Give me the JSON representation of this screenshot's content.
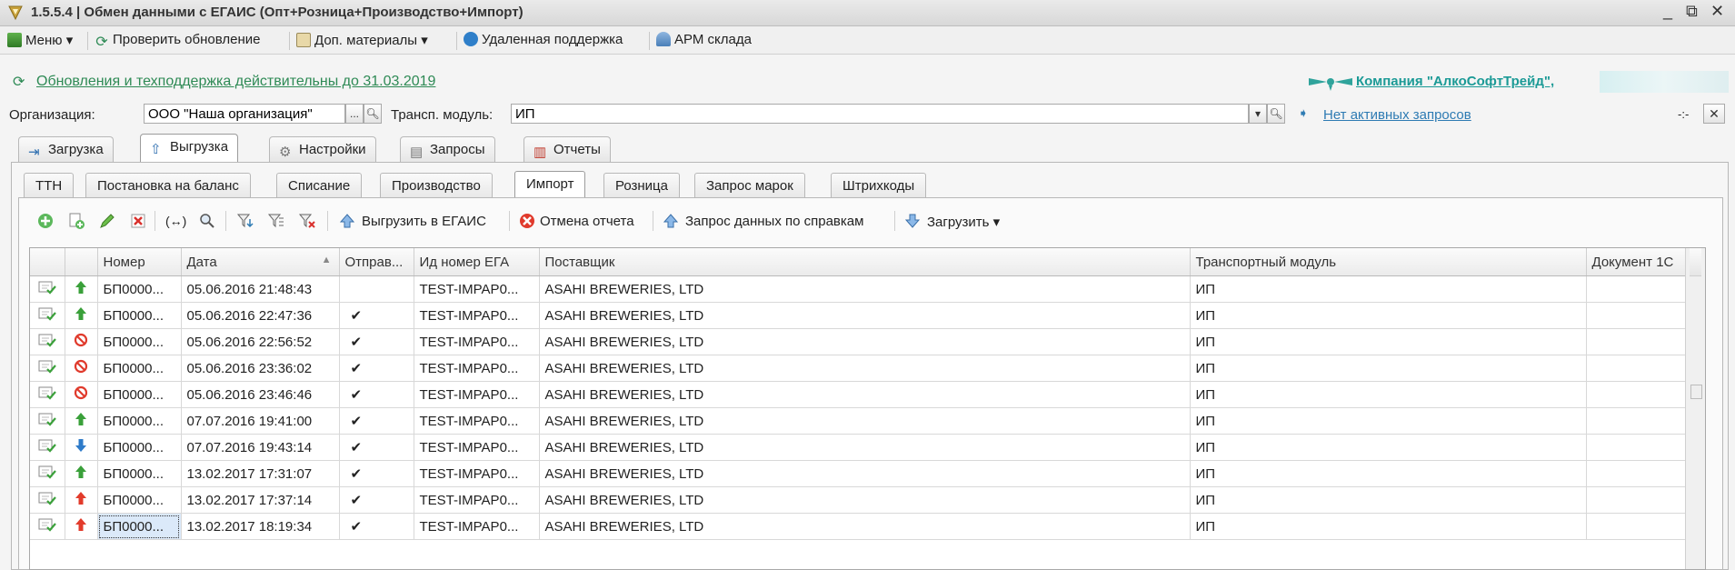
{
  "window": {
    "title": "1.5.5.4 | Обмен данными с ЕГАИС (Опт+Розница+Производство+Импорт)",
    "controls": [
      "_",
      "⧉",
      "✕"
    ]
  },
  "menubar": {
    "items": [
      {
        "label": "Меню ▾",
        "icon": "menu-icon"
      },
      {
        "label": "Проверить обновление",
        "icon": "refresh-icon"
      },
      {
        "label": "Доп. материалы ▾",
        "icon": "clipboard-icon"
      },
      {
        "label": "Удаленная поддержка",
        "icon": "remote-support-icon"
      },
      {
        "label": "АРМ склада",
        "icon": "warehouse-user-icon"
      }
    ]
  },
  "notice": {
    "text": "Обновления и техподдержка действительны до 31.03.2019",
    "company": "Компания \"АлкоСофтТрейд\","
  },
  "filters": {
    "org_label": "Организация:",
    "org_value": "ООО \"Наша организация\"",
    "org_btn": "...",
    "module_label": "Трансп. модуль:",
    "module_value": "ИП",
    "requests_link": "Нет активных запросов",
    "right_mark": "-:-"
  },
  "main_tabs": [
    "Загрузка",
    "Выгрузка",
    "Настройки",
    "Запросы",
    "Отчеты"
  ],
  "sub_tabs": [
    "ТТН",
    "Постановка на баланс",
    "Списание",
    "Производство",
    "Импорт",
    "Розница",
    "Запрос марок",
    "Штрихкоды"
  ],
  "toolbar": {
    "upload": "Выгрузить в ЕГАИС",
    "cancel_report": "Отмена отчета",
    "request_data": "Запрос данных по справкам",
    "load": "Загрузить ▾"
  },
  "grid": {
    "columns": [
      "",
      "",
      "Номер",
      "Дата",
      "Отправ...",
      "Ид номер ЕГА",
      "Поставщик",
      "Транспортный модуль",
      "Документ 1С"
    ],
    "sort_indicator": "▲",
    "rows": [
      {
        "dir": "up-green",
        "num": "БП0000...",
        "date": "05.06.2016 21:48:43",
        "sent": "",
        "ega": "TEST-IMPAP0...",
        "supplier": "ASAHI BREWERIES, LTD",
        "module": "ИП",
        "doc": ""
      },
      {
        "dir": "up-green",
        "num": "БП0000...",
        "date": "05.06.2016 22:47:36",
        "sent": "✔",
        "ega": "TEST-IMPAP0...",
        "supplier": "ASAHI BREWERIES, LTD",
        "module": "ИП",
        "doc": ""
      },
      {
        "dir": "cancel",
        "num": "БП0000...",
        "date": "05.06.2016 22:56:52",
        "sent": "✔",
        "ega": "TEST-IMPAP0...",
        "supplier": "ASAHI BREWERIES, LTD",
        "module": "ИП",
        "doc": ""
      },
      {
        "dir": "cancel",
        "num": "БП0000...",
        "date": "05.06.2016 23:36:02",
        "sent": "✔",
        "ega": "TEST-IMPAP0...",
        "supplier": "ASAHI BREWERIES, LTD",
        "module": "ИП",
        "doc": ""
      },
      {
        "dir": "cancel",
        "num": "БП0000...",
        "date": "05.06.2016 23:46:46",
        "sent": "✔",
        "ega": "TEST-IMPAP0...",
        "supplier": "ASAHI BREWERIES, LTD",
        "module": "ИП",
        "doc": ""
      },
      {
        "dir": "up-green",
        "num": "БП0000...",
        "date": "07.07.2016 19:41:00",
        "sent": "✔",
        "ega": "TEST-IMPAP0...",
        "supplier": "ASAHI BREWERIES, LTD",
        "module": "ИП",
        "doc": ""
      },
      {
        "dir": "down-blue",
        "num": "БП0000...",
        "date": "07.07.2016 19:43:14",
        "sent": "✔",
        "ega": "TEST-IMPAP0...",
        "supplier": "ASAHI BREWERIES, LTD",
        "module": "ИП",
        "doc": ""
      },
      {
        "dir": "up-green",
        "num": "БП0000...",
        "date": "13.02.2017 17:31:07",
        "sent": "✔",
        "ega": "TEST-IMPAP0...",
        "supplier": "ASAHI BREWERIES, LTD",
        "module": "ИП",
        "doc": ""
      },
      {
        "dir": "up-red",
        "num": "БП0000...",
        "date": "13.02.2017 17:37:14",
        "sent": "✔",
        "ega": "TEST-IMPAP0...",
        "supplier": "ASAHI BREWERIES, LTD",
        "module": "ИП",
        "doc": ""
      },
      {
        "dir": "up-red",
        "num": "БП0000...",
        "date": "13.02.2017 18:19:34",
        "sent": "✔",
        "ega": "TEST-IMPAP0...",
        "supplier": "ASAHI BREWERIES, LTD",
        "module": "ИП",
        "doc": ""
      }
    ]
  },
  "colors": {
    "accent_green": "#2e8a55",
    "link_blue": "#2e7bb3",
    "cancel_red": "#e03a2c"
  }
}
